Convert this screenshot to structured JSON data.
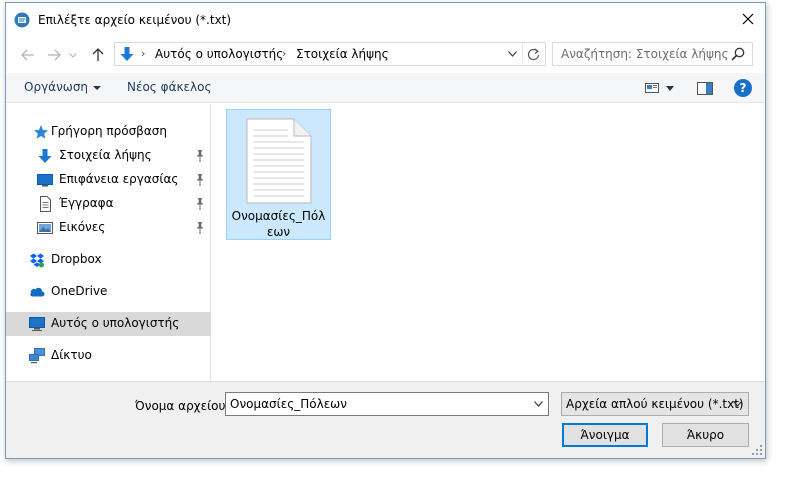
{
  "window": {
    "title": "Επιλέξτε αρχείο κειμένου (*.txt)"
  },
  "navigation": {
    "breadcrumb": [
      "Αυτός ο υπολογιστής",
      "Στοιχεία λήψης"
    ],
    "search_placeholder": "Αναζήτηση: Στοιχεία λήψης"
  },
  "commandbar": {
    "organize_label": "Οργάνωση",
    "new_folder_label": "Νέος φάκελος",
    "help_label": "?"
  },
  "sidebar": {
    "items": [
      {
        "label": "Γρήγορη πρόσβαση",
        "icon": "star-icon",
        "pinned": false,
        "selected": false
      },
      {
        "label": "Στοιχεία λήψης",
        "icon": "download-arrow-icon",
        "pinned": true,
        "selected": false
      },
      {
        "label": "Επιφάνεια εργασίας",
        "icon": "desktop-icon",
        "pinned": true,
        "selected": false
      },
      {
        "label": "Έγγραφα",
        "icon": "document-icon",
        "pinned": true,
        "selected": false
      },
      {
        "label": "Εικόνες",
        "icon": "pictures-icon",
        "pinned": true,
        "selected": false
      },
      {
        "label": "Dropbox",
        "icon": "dropbox-icon",
        "pinned": false,
        "selected": false
      },
      {
        "label": "OneDrive",
        "icon": "onedrive-cloud-icon",
        "pinned": false,
        "selected": false
      },
      {
        "label": "Αυτός ο υπολογιστής",
        "icon": "computer-icon",
        "pinned": false,
        "selected": true
      },
      {
        "label": "Δίκτυο",
        "icon": "network-icon",
        "pinned": false,
        "selected": false
      }
    ]
  },
  "content": {
    "files": [
      {
        "name": "Ονομασίες_Πόλεων",
        "icon": "text-file-icon",
        "selected": true
      }
    ]
  },
  "footer": {
    "filename_label": "Όνομα αρχείου:",
    "filename_value": "Ονομασίες_Πόλεων",
    "filetype_value": "Αρχεία απλού κειμένου (*.txt)",
    "open_button": "Άνοιγμα",
    "cancel_button": "Άκυρο"
  },
  "colors": {
    "accent": "#0078d7",
    "selection_fill": "#cce8ff",
    "selection_border": "#99d1ff",
    "help_blue": "#1a6fc9"
  }
}
